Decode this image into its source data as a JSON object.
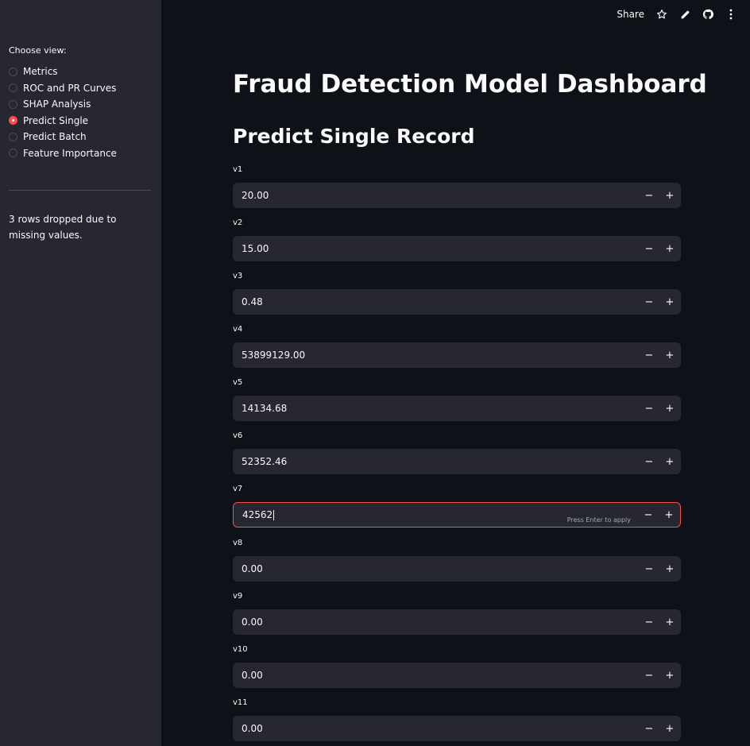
{
  "sidebar": {
    "label": "Choose view:",
    "options": [
      {
        "label": "Metrics",
        "selected": false
      },
      {
        "label": "ROC and PR Curves",
        "selected": false
      },
      {
        "label": "SHAP Analysis",
        "selected": false
      },
      {
        "label": "Predict Single",
        "selected": true
      },
      {
        "label": "Predict Batch",
        "selected": false
      },
      {
        "label": "Feature Importance",
        "selected": false
      }
    ],
    "note": "3 rows dropped due to missing values."
  },
  "toolbar": {
    "share_label": "Share",
    "icons": [
      "star-icon",
      "edit-icon",
      "github-icon",
      "more-icon"
    ]
  },
  "main": {
    "title": "Fraud Detection Model Dashboard",
    "subtitle": "Predict Single Record",
    "fields": [
      {
        "label": "v1",
        "value": "20.00"
      },
      {
        "label": "v2",
        "value": "15.00"
      },
      {
        "label": "v3",
        "value": "0.48"
      },
      {
        "label": "v4",
        "value": "53899129.00"
      },
      {
        "label": "v5",
        "value": "14134.68"
      },
      {
        "label": "v6",
        "value": "52352.46"
      },
      {
        "label": "v7",
        "value": "42562",
        "focused": true,
        "hint": "Press Enter to apply"
      },
      {
        "label": "v8",
        "value": "0.00"
      },
      {
        "label": "v9",
        "value": "0.00"
      },
      {
        "label": "v10",
        "value": "0.00"
      },
      {
        "label": "v11",
        "value": "0.00"
      }
    ],
    "stepper": {
      "minus": "−",
      "plus": "+"
    }
  },
  "colors": {
    "background": "#0e1117",
    "sidebar": "#262730",
    "input": "#262730",
    "accent": "#ff4b4b",
    "text": "#fafafa"
  }
}
